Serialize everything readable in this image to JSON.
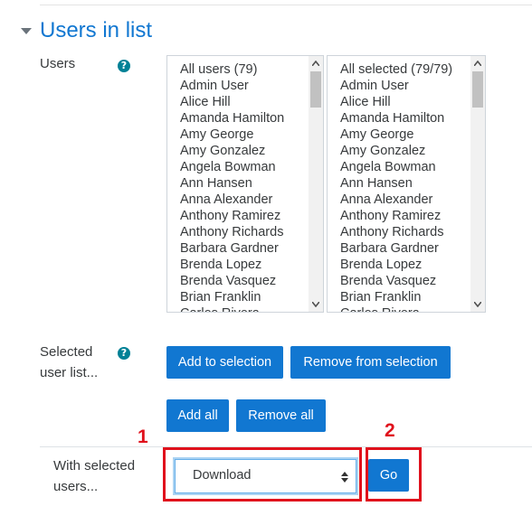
{
  "section": {
    "title": "Users in list"
  },
  "users_field": {
    "label": "Users"
  },
  "available_list": {
    "items": [
      "All users (79)",
      "Admin User",
      "Alice Hill",
      "Amanda Hamilton",
      "Amy George",
      "Amy Gonzalez",
      "Angela Bowman",
      "Ann Hansen",
      "Anna Alexander",
      "Anthony Ramirez",
      "Anthony Richards",
      "Barbara Gardner",
      "Brenda Lopez",
      "Brenda Vasquez",
      "Brian Franklin",
      "Carlos Rivera"
    ]
  },
  "selected_list": {
    "items": [
      "All selected (79/79)",
      "Admin User",
      "Alice Hill",
      "Amanda Hamilton",
      "Amy George",
      "Amy Gonzalez",
      "Angela Bowman",
      "Ann Hansen",
      "Anna Alexander",
      "Anthony Ramirez",
      "Anthony Richards",
      "Barbara Gardner",
      "Brenda Lopez",
      "Brenda Vasquez",
      "Brian Franklin",
      "Carlos Rivera"
    ]
  },
  "selected_user_list": {
    "label_line1": "Selected",
    "label_line2": "user list...",
    "add_to_selection": "Add to selection",
    "remove_from_selection": "Remove from selection",
    "add_all": "Add all",
    "remove_all": "Remove all"
  },
  "with_selected": {
    "label_line1": "With selected",
    "label_line2": "users...",
    "action_value": "Download",
    "go": "Go"
  },
  "annotations": {
    "marker_1": "1",
    "marker_2": "2",
    "color": "#e0111c"
  },
  "colors": {
    "accent": "#1177d1",
    "help_icon": "#008196"
  }
}
